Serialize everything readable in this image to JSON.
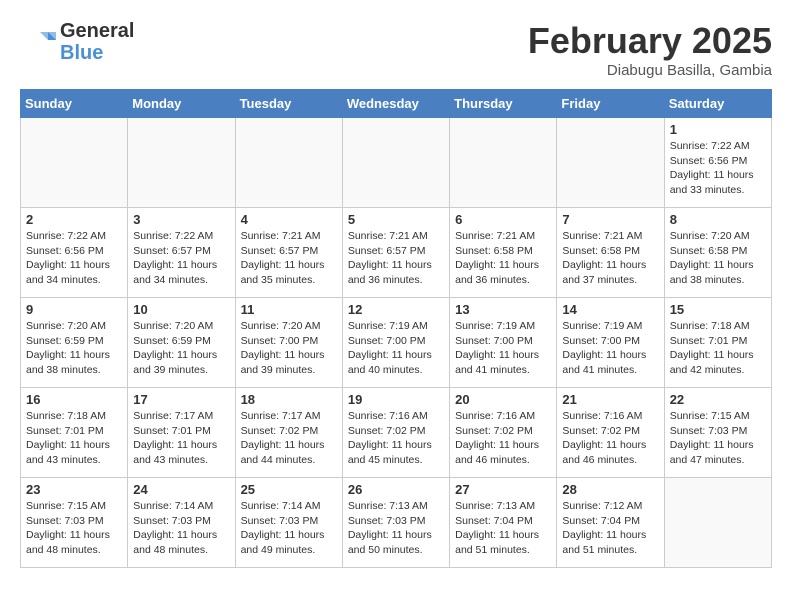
{
  "header": {
    "logo_general": "General",
    "logo_blue": "Blue",
    "month_year": "February 2025",
    "location": "Diabugu Basilla, Gambia"
  },
  "days_of_week": [
    "Sunday",
    "Monday",
    "Tuesday",
    "Wednesday",
    "Thursday",
    "Friday",
    "Saturday"
  ],
  "weeks": [
    [
      {
        "day": "",
        "info": ""
      },
      {
        "day": "",
        "info": ""
      },
      {
        "day": "",
        "info": ""
      },
      {
        "day": "",
        "info": ""
      },
      {
        "day": "",
        "info": ""
      },
      {
        "day": "",
        "info": ""
      },
      {
        "day": "1",
        "info": "Sunrise: 7:22 AM\nSunset: 6:56 PM\nDaylight: 11 hours\nand 33 minutes."
      }
    ],
    [
      {
        "day": "2",
        "info": "Sunrise: 7:22 AM\nSunset: 6:56 PM\nDaylight: 11 hours\nand 34 minutes."
      },
      {
        "day": "3",
        "info": "Sunrise: 7:22 AM\nSunset: 6:57 PM\nDaylight: 11 hours\nand 34 minutes."
      },
      {
        "day": "4",
        "info": "Sunrise: 7:21 AM\nSunset: 6:57 PM\nDaylight: 11 hours\nand 35 minutes."
      },
      {
        "day": "5",
        "info": "Sunrise: 7:21 AM\nSunset: 6:57 PM\nDaylight: 11 hours\nand 36 minutes."
      },
      {
        "day": "6",
        "info": "Sunrise: 7:21 AM\nSunset: 6:58 PM\nDaylight: 11 hours\nand 36 minutes."
      },
      {
        "day": "7",
        "info": "Sunrise: 7:21 AM\nSunset: 6:58 PM\nDaylight: 11 hours\nand 37 minutes."
      },
      {
        "day": "8",
        "info": "Sunrise: 7:20 AM\nSunset: 6:58 PM\nDaylight: 11 hours\nand 38 minutes."
      }
    ],
    [
      {
        "day": "9",
        "info": "Sunrise: 7:20 AM\nSunset: 6:59 PM\nDaylight: 11 hours\nand 38 minutes."
      },
      {
        "day": "10",
        "info": "Sunrise: 7:20 AM\nSunset: 6:59 PM\nDaylight: 11 hours\nand 39 minutes."
      },
      {
        "day": "11",
        "info": "Sunrise: 7:20 AM\nSunset: 7:00 PM\nDaylight: 11 hours\nand 39 minutes."
      },
      {
        "day": "12",
        "info": "Sunrise: 7:19 AM\nSunset: 7:00 PM\nDaylight: 11 hours\nand 40 minutes."
      },
      {
        "day": "13",
        "info": "Sunrise: 7:19 AM\nSunset: 7:00 PM\nDaylight: 11 hours\nand 41 minutes."
      },
      {
        "day": "14",
        "info": "Sunrise: 7:19 AM\nSunset: 7:00 PM\nDaylight: 11 hours\nand 41 minutes."
      },
      {
        "day": "15",
        "info": "Sunrise: 7:18 AM\nSunset: 7:01 PM\nDaylight: 11 hours\nand 42 minutes."
      }
    ],
    [
      {
        "day": "16",
        "info": "Sunrise: 7:18 AM\nSunset: 7:01 PM\nDaylight: 11 hours\nand 43 minutes."
      },
      {
        "day": "17",
        "info": "Sunrise: 7:17 AM\nSunset: 7:01 PM\nDaylight: 11 hours\nand 43 minutes."
      },
      {
        "day": "18",
        "info": "Sunrise: 7:17 AM\nSunset: 7:02 PM\nDaylight: 11 hours\nand 44 minutes."
      },
      {
        "day": "19",
        "info": "Sunrise: 7:16 AM\nSunset: 7:02 PM\nDaylight: 11 hours\nand 45 minutes."
      },
      {
        "day": "20",
        "info": "Sunrise: 7:16 AM\nSunset: 7:02 PM\nDaylight: 11 hours\nand 46 minutes."
      },
      {
        "day": "21",
        "info": "Sunrise: 7:16 AM\nSunset: 7:02 PM\nDaylight: 11 hours\nand 46 minutes."
      },
      {
        "day": "22",
        "info": "Sunrise: 7:15 AM\nSunset: 7:03 PM\nDaylight: 11 hours\nand 47 minutes."
      }
    ],
    [
      {
        "day": "23",
        "info": "Sunrise: 7:15 AM\nSunset: 7:03 PM\nDaylight: 11 hours\nand 48 minutes."
      },
      {
        "day": "24",
        "info": "Sunrise: 7:14 AM\nSunset: 7:03 PM\nDaylight: 11 hours\nand 48 minutes."
      },
      {
        "day": "25",
        "info": "Sunrise: 7:14 AM\nSunset: 7:03 PM\nDaylight: 11 hours\nand 49 minutes."
      },
      {
        "day": "26",
        "info": "Sunrise: 7:13 AM\nSunset: 7:03 PM\nDaylight: 11 hours\nand 50 minutes."
      },
      {
        "day": "27",
        "info": "Sunrise: 7:13 AM\nSunset: 7:04 PM\nDaylight: 11 hours\nand 51 minutes."
      },
      {
        "day": "28",
        "info": "Sunrise: 7:12 AM\nSunset: 7:04 PM\nDaylight: 11 hours\nand 51 minutes."
      },
      {
        "day": "",
        "info": ""
      }
    ]
  ]
}
